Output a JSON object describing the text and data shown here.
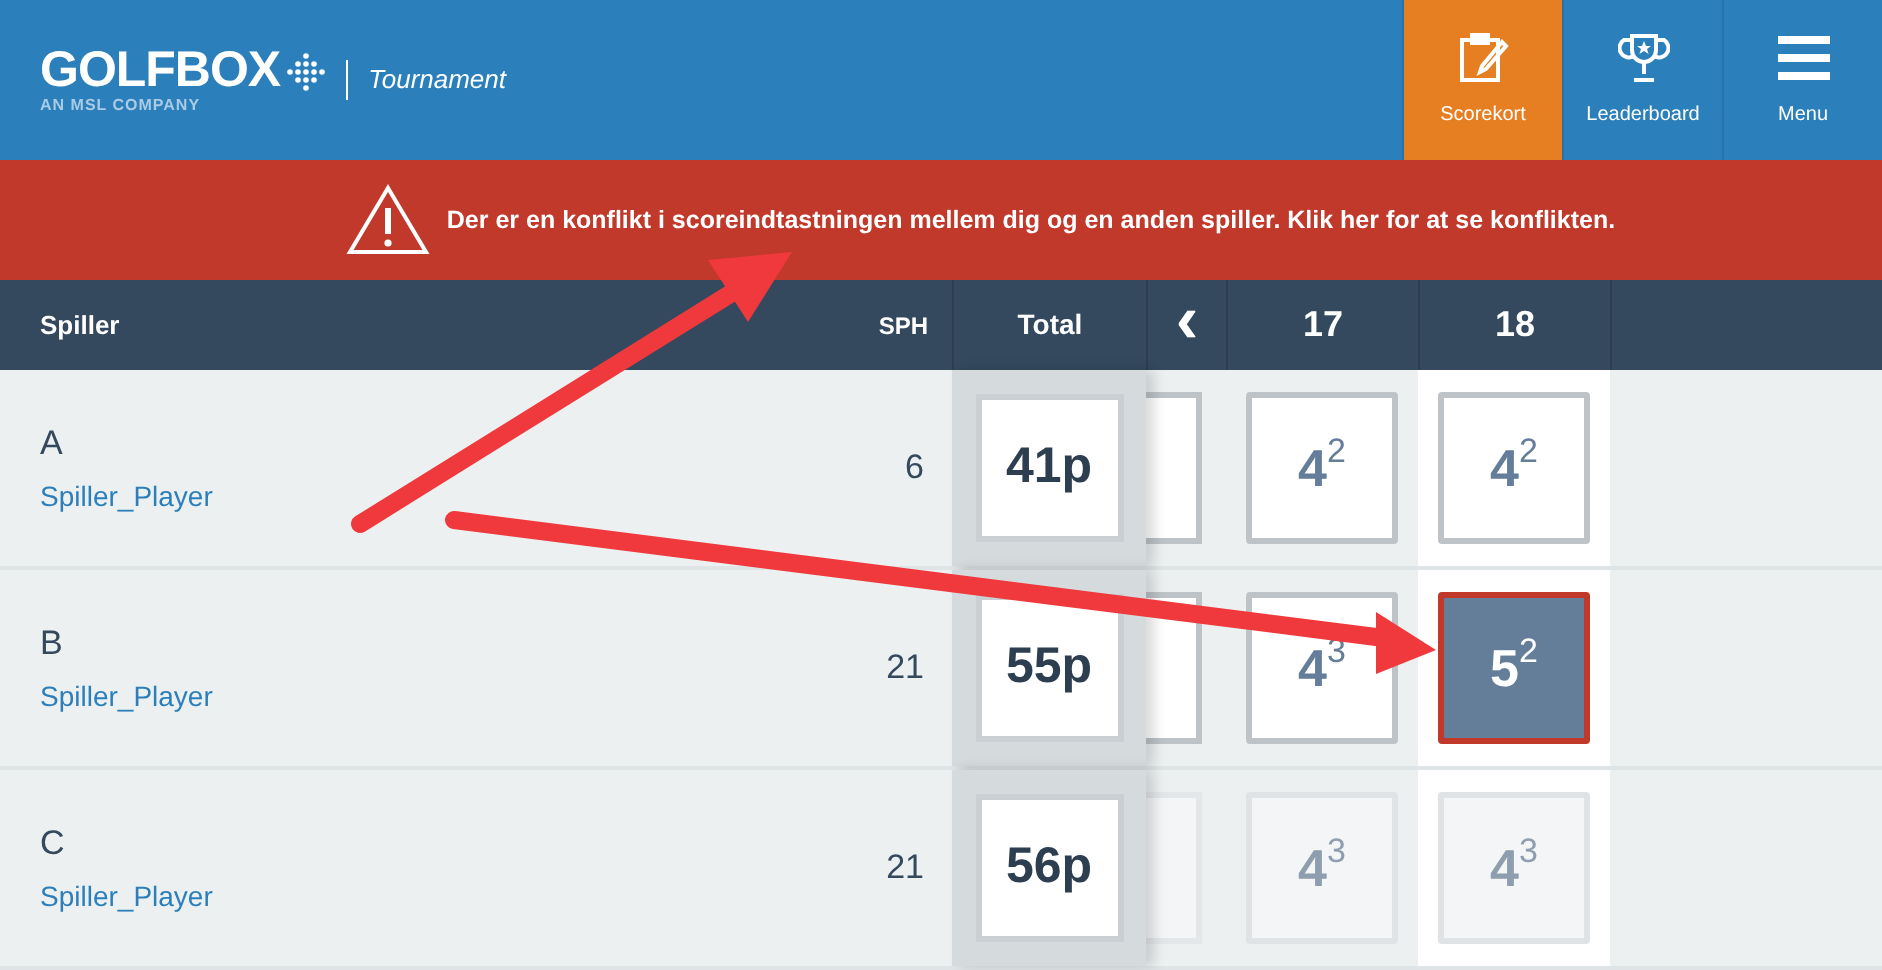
{
  "header": {
    "logo": "GOLFBOX",
    "logo_tagline": "AN MSL COMPANY",
    "product": "Tournament",
    "nav": [
      {
        "kind": "scorecard",
        "label": "Scorekort",
        "selected": true
      },
      {
        "kind": "trophy",
        "label": "Leaderboard",
        "selected": false
      },
      {
        "kind": "menu",
        "label": "Menu",
        "selected": false
      }
    ]
  },
  "alert": {
    "message": "Der er en konflikt i scoreindtastningen mellem dig og en anden spiller. Klik her for at se konflikten."
  },
  "table": {
    "columns": {
      "player": "Spiller",
      "sph": "SPH",
      "total": "Total",
      "prev": "‹",
      "holes": [
        "17",
        "18"
      ]
    },
    "rows": [
      {
        "name": "A",
        "subtitle": "Spiller_Player",
        "sph": "6",
        "total": "41p",
        "faded": false,
        "scores": [
          {
            "strokes": "4",
            "points": "2",
            "conflict": false
          },
          {
            "strokes": "4",
            "points": "2",
            "conflict": false
          }
        ]
      },
      {
        "name": "B",
        "subtitle": "Spiller_Player",
        "sph": "21",
        "total": "55p",
        "faded": false,
        "scores": [
          {
            "strokes": "4",
            "points": "3",
            "conflict": false
          },
          {
            "strokes": "5",
            "points": "2",
            "conflict": true
          }
        ]
      },
      {
        "name": "C",
        "subtitle": "Spiller_Player",
        "sph": "21",
        "total": "56p",
        "faded": true,
        "scores": [
          {
            "strokes": "4",
            "points": "3",
            "conflict": false
          },
          {
            "strokes": "4",
            "points": "3",
            "conflict": false
          }
        ]
      }
    ]
  }
}
